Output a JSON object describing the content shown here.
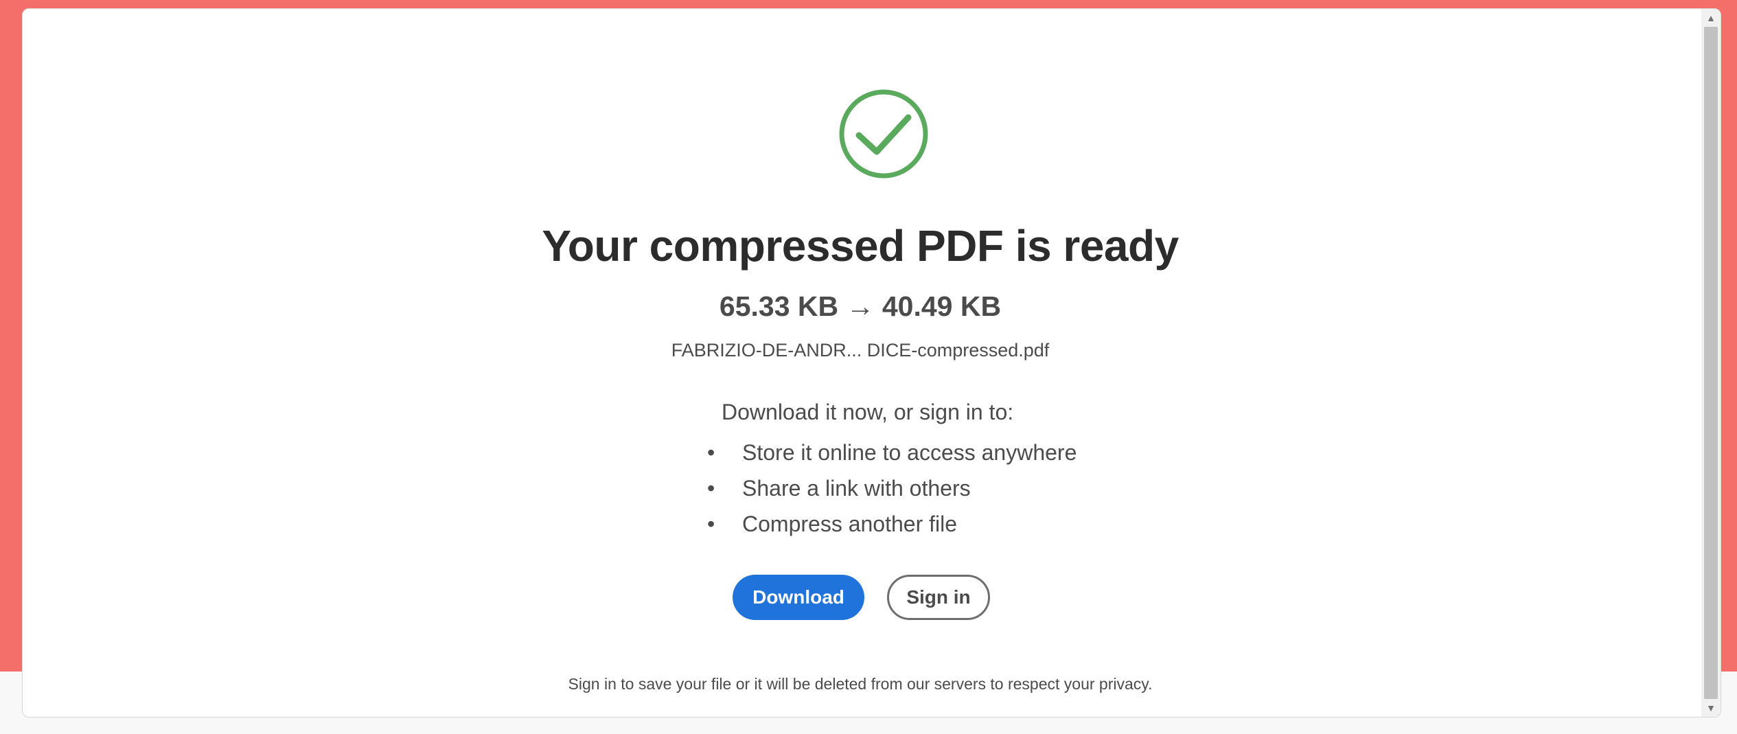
{
  "result": {
    "title": "Your compressed PDF is ready",
    "sizes": "65.33 KB → 40.49 KB",
    "filename": "FABRIZIO-DE-ANDR...  DICE-compressed.pdf"
  },
  "benefits": {
    "intro": "Download it now, or sign in to:",
    "items": [
      "Store it online to access anywhere",
      "Share a link with others",
      "Compress another file"
    ]
  },
  "actions": {
    "download_label": "Download",
    "signin_label": "Sign in"
  },
  "notice": "Sign in to save your file or it will be deleted from our servers to respect your privacy.",
  "icons": {
    "success": "checkmark-circle-icon",
    "scroll_up": "scroll-up-arrow-icon",
    "scroll_down": "scroll-down-arrow-icon"
  },
  "colors": {
    "backdrop": "#f46f69",
    "success": "#5aaa5e",
    "primary": "#1f73da"
  }
}
